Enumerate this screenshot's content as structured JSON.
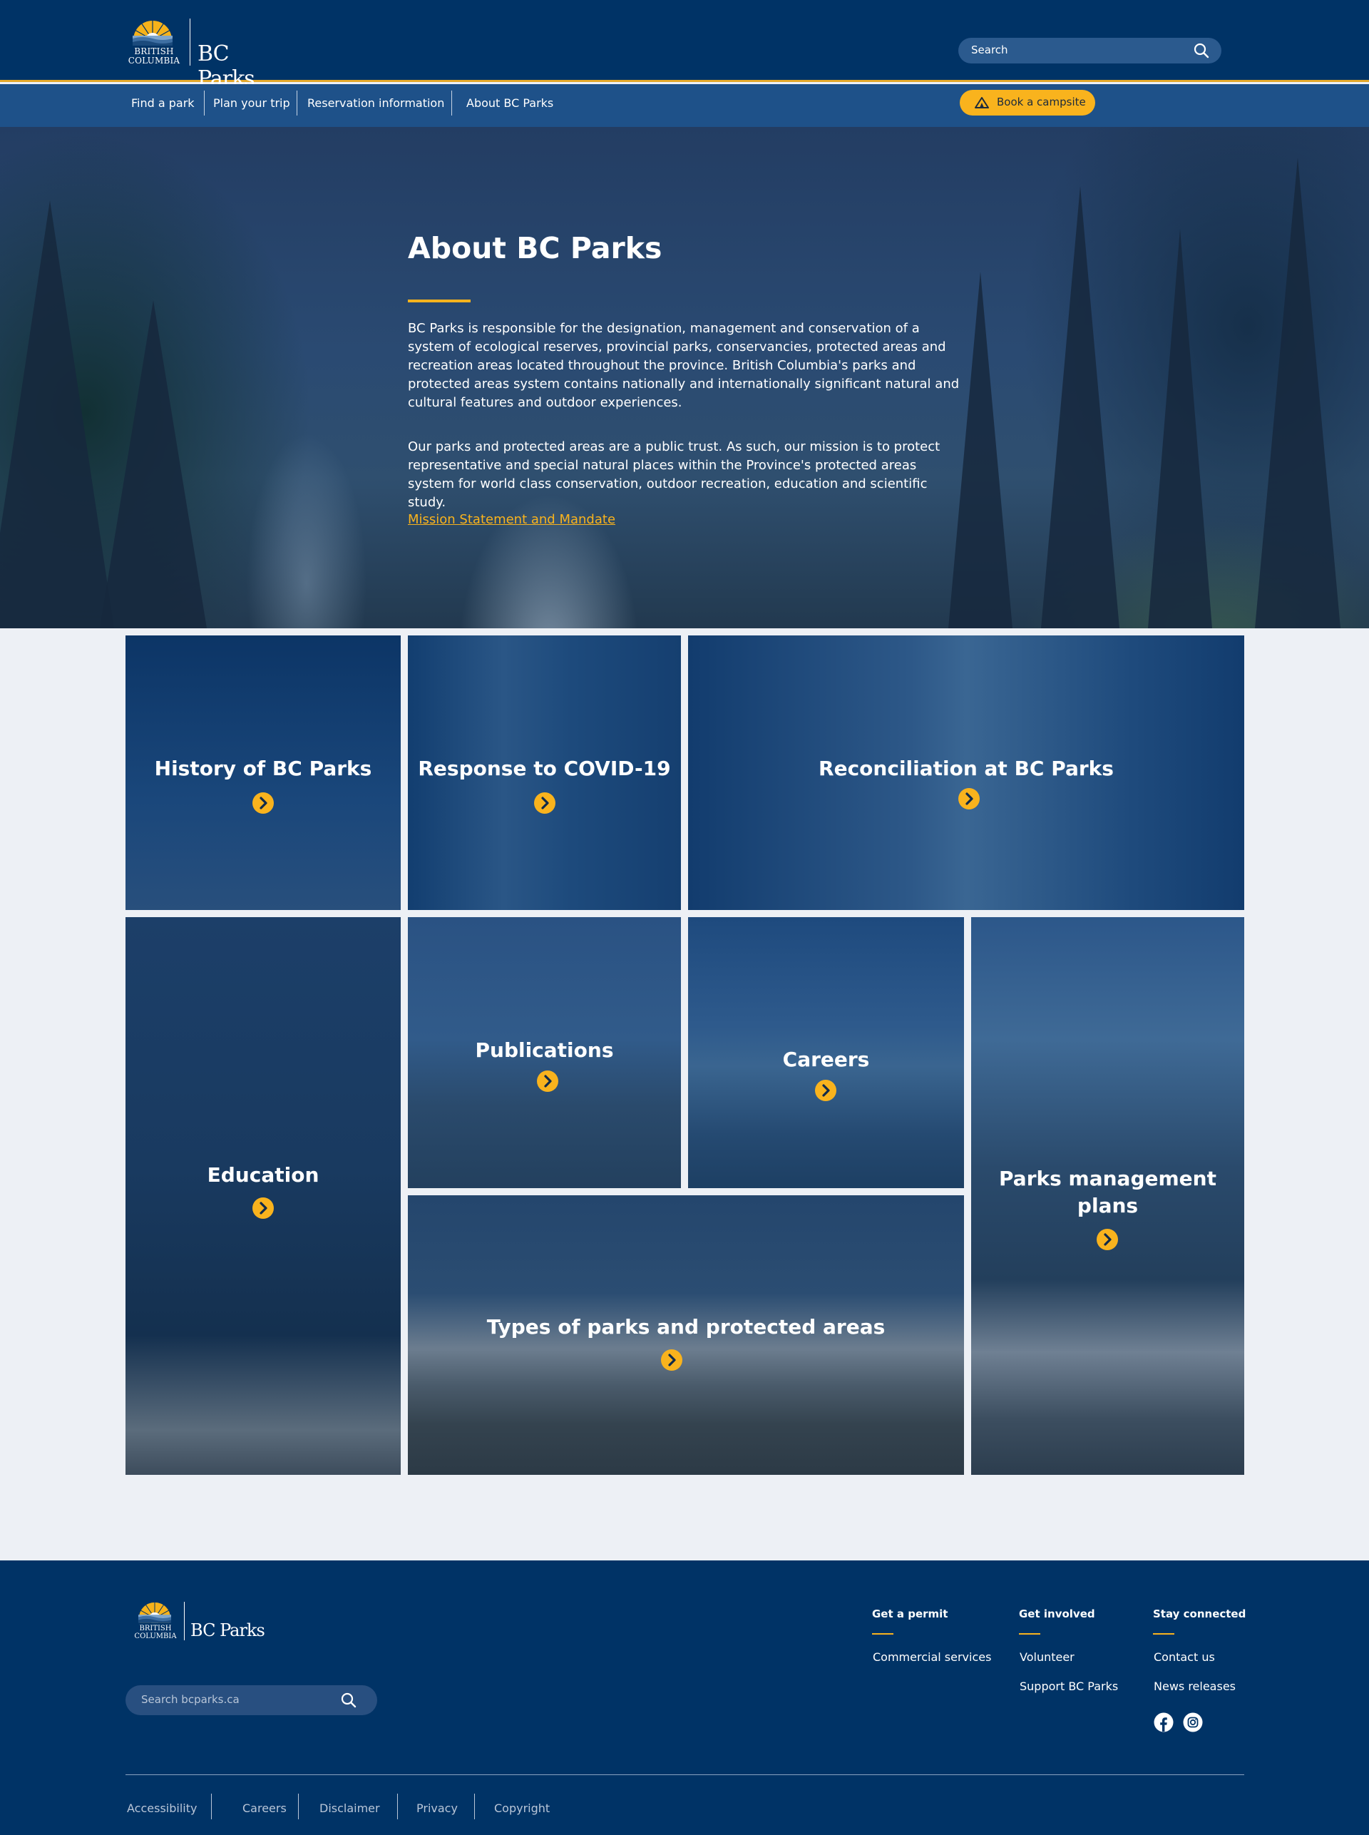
{
  "header": {
    "logo_small_1": "BRITISH",
    "logo_small_2": "COLUMBIA",
    "logo_text": "BC Parks",
    "search_placeholder": "Search"
  },
  "nav": {
    "items": [
      "Find a park",
      "Plan your trip",
      "Reservation information",
      "About BC Parks"
    ],
    "book_label": "Book a campsite"
  },
  "hero": {
    "title": "About BC Parks",
    "paragraph_1": "BC Parks is responsible for the designation, management and conservation of a system of ecological reserves, provincial parks, conservancies, protected areas and recreation areas located throughout the province. British Columbia's parks and protected areas system contains nationally and internationally significant natural and cultural features and outdoor experiences.",
    "paragraph_2": "Our parks and protected areas are a public trust. As such, our mission is to protect representative and special natural places within the Province's protected areas system for world class conservation, outdoor recreation, education and scientific study.",
    "link": "Mission Statement and Mandate"
  },
  "tiles": {
    "history": "History of BC Parks",
    "covid": "Response to COVID-19",
    "reconciliation": "Reconciliation at BC Parks",
    "education": "Education",
    "publications": "Publications",
    "careers": "Careers",
    "management_1": "Parks management",
    "management_2": "plans",
    "types": "Types of parks and protected areas"
  },
  "footer": {
    "logo_small_1": "BRITISH",
    "logo_small_2": "COLUMBIA",
    "logo_text": "BC Parks",
    "search_placeholder": "Search bcparks.ca",
    "col_permit": {
      "heading": "Get a permit",
      "links": [
        "Commercial services"
      ]
    },
    "col_involved": {
      "heading": "Get involved",
      "links": [
        "Volunteer",
        "Support BC Parks"
      ]
    },
    "col_connected": {
      "heading": "Stay connected",
      "links": [
        "Contact us",
        "News releases"
      ]
    },
    "social_icons": [
      "facebook-icon",
      "instagram-icon"
    ],
    "bottom_links": [
      "Accessibility",
      "Careers",
      "Disclaimer",
      "Privacy",
      "Copyright"
    ]
  },
  "colors": {
    "navy": "#003366",
    "nav_blue": "#1e5189",
    "accent_gold": "#f9b31d",
    "page_bg": "#edf0f5"
  }
}
